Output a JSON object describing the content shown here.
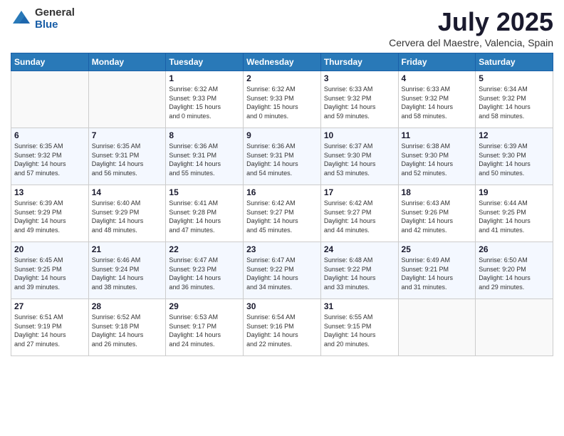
{
  "logo": {
    "general": "General",
    "blue": "Blue"
  },
  "title": "July 2025",
  "subtitle": "Cervera del Maestre, Valencia, Spain",
  "days_of_week": [
    "Sunday",
    "Monday",
    "Tuesday",
    "Wednesday",
    "Thursday",
    "Friday",
    "Saturday"
  ],
  "weeks": [
    [
      {
        "day": "",
        "info": ""
      },
      {
        "day": "",
        "info": ""
      },
      {
        "day": "1",
        "info": "Sunrise: 6:32 AM\nSunset: 9:33 PM\nDaylight: 15 hours\nand 0 minutes."
      },
      {
        "day": "2",
        "info": "Sunrise: 6:32 AM\nSunset: 9:33 PM\nDaylight: 15 hours\nand 0 minutes."
      },
      {
        "day": "3",
        "info": "Sunrise: 6:33 AM\nSunset: 9:32 PM\nDaylight: 14 hours\nand 59 minutes."
      },
      {
        "day": "4",
        "info": "Sunrise: 6:33 AM\nSunset: 9:32 PM\nDaylight: 14 hours\nand 58 minutes."
      },
      {
        "day": "5",
        "info": "Sunrise: 6:34 AM\nSunset: 9:32 PM\nDaylight: 14 hours\nand 58 minutes."
      }
    ],
    [
      {
        "day": "6",
        "info": "Sunrise: 6:35 AM\nSunset: 9:32 PM\nDaylight: 14 hours\nand 57 minutes."
      },
      {
        "day": "7",
        "info": "Sunrise: 6:35 AM\nSunset: 9:31 PM\nDaylight: 14 hours\nand 56 minutes."
      },
      {
        "day": "8",
        "info": "Sunrise: 6:36 AM\nSunset: 9:31 PM\nDaylight: 14 hours\nand 55 minutes."
      },
      {
        "day": "9",
        "info": "Sunrise: 6:36 AM\nSunset: 9:31 PM\nDaylight: 14 hours\nand 54 minutes."
      },
      {
        "day": "10",
        "info": "Sunrise: 6:37 AM\nSunset: 9:30 PM\nDaylight: 14 hours\nand 53 minutes."
      },
      {
        "day": "11",
        "info": "Sunrise: 6:38 AM\nSunset: 9:30 PM\nDaylight: 14 hours\nand 52 minutes."
      },
      {
        "day": "12",
        "info": "Sunrise: 6:39 AM\nSunset: 9:30 PM\nDaylight: 14 hours\nand 50 minutes."
      }
    ],
    [
      {
        "day": "13",
        "info": "Sunrise: 6:39 AM\nSunset: 9:29 PM\nDaylight: 14 hours\nand 49 minutes."
      },
      {
        "day": "14",
        "info": "Sunrise: 6:40 AM\nSunset: 9:29 PM\nDaylight: 14 hours\nand 48 minutes."
      },
      {
        "day": "15",
        "info": "Sunrise: 6:41 AM\nSunset: 9:28 PM\nDaylight: 14 hours\nand 47 minutes."
      },
      {
        "day": "16",
        "info": "Sunrise: 6:42 AM\nSunset: 9:27 PM\nDaylight: 14 hours\nand 45 minutes."
      },
      {
        "day": "17",
        "info": "Sunrise: 6:42 AM\nSunset: 9:27 PM\nDaylight: 14 hours\nand 44 minutes."
      },
      {
        "day": "18",
        "info": "Sunrise: 6:43 AM\nSunset: 9:26 PM\nDaylight: 14 hours\nand 42 minutes."
      },
      {
        "day": "19",
        "info": "Sunrise: 6:44 AM\nSunset: 9:25 PM\nDaylight: 14 hours\nand 41 minutes."
      }
    ],
    [
      {
        "day": "20",
        "info": "Sunrise: 6:45 AM\nSunset: 9:25 PM\nDaylight: 14 hours\nand 39 minutes."
      },
      {
        "day": "21",
        "info": "Sunrise: 6:46 AM\nSunset: 9:24 PM\nDaylight: 14 hours\nand 38 minutes."
      },
      {
        "day": "22",
        "info": "Sunrise: 6:47 AM\nSunset: 9:23 PM\nDaylight: 14 hours\nand 36 minutes."
      },
      {
        "day": "23",
        "info": "Sunrise: 6:47 AM\nSunset: 9:22 PM\nDaylight: 14 hours\nand 34 minutes."
      },
      {
        "day": "24",
        "info": "Sunrise: 6:48 AM\nSunset: 9:22 PM\nDaylight: 14 hours\nand 33 minutes."
      },
      {
        "day": "25",
        "info": "Sunrise: 6:49 AM\nSunset: 9:21 PM\nDaylight: 14 hours\nand 31 minutes."
      },
      {
        "day": "26",
        "info": "Sunrise: 6:50 AM\nSunset: 9:20 PM\nDaylight: 14 hours\nand 29 minutes."
      }
    ],
    [
      {
        "day": "27",
        "info": "Sunrise: 6:51 AM\nSunset: 9:19 PM\nDaylight: 14 hours\nand 27 minutes."
      },
      {
        "day": "28",
        "info": "Sunrise: 6:52 AM\nSunset: 9:18 PM\nDaylight: 14 hours\nand 26 minutes."
      },
      {
        "day": "29",
        "info": "Sunrise: 6:53 AM\nSunset: 9:17 PM\nDaylight: 14 hours\nand 24 minutes."
      },
      {
        "day": "30",
        "info": "Sunrise: 6:54 AM\nSunset: 9:16 PM\nDaylight: 14 hours\nand 22 minutes."
      },
      {
        "day": "31",
        "info": "Sunrise: 6:55 AM\nSunset: 9:15 PM\nDaylight: 14 hours\nand 20 minutes."
      },
      {
        "day": "",
        "info": ""
      },
      {
        "day": "",
        "info": ""
      }
    ]
  ]
}
